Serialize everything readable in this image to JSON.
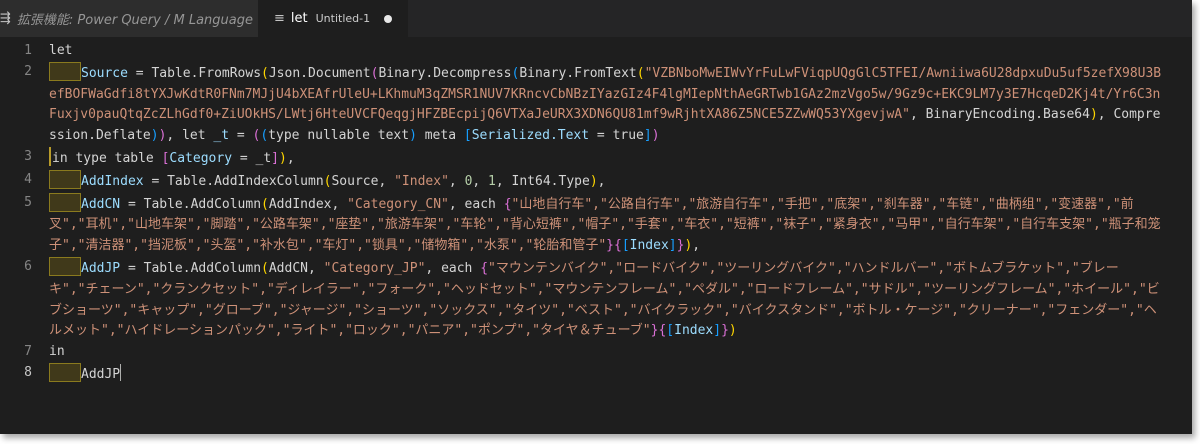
{
  "tabs": [
    {
      "label": "拡張機能: Power Query / M Language",
      "icon": "preview-icon",
      "icon_glyph": "⇶"
    },
    {
      "name": "let",
      "desc": "Untitled-1",
      "icon": "text-lines-icon",
      "icon_glyph": "≡",
      "dirty": true
    }
  ],
  "gutter": {
    "l1": "1",
    "l2": "2",
    "l3": "3",
    "l4": "4",
    "l5": "5",
    "l6": "6",
    "l7": "7",
    "l8": "8"
  },
  "code": {
    "let": "let",
    "in": "in",
    "source_var": "Source",
    "table_fromrows": "Table.FromRows",
    "json_document": "Json.Document",
    "binary_decompress": "Binary.Decompress",
    "binary_fromtext": "Binary.FromText",
    "b64_string": "\"VZBNboMwEIWvYrFuLwFViqpUQgGlC5TFEI/Awniiwa6U28dpxuDu5uf5zefX98U3BefBOFWaGdfi8tYXJwKdtR0FNm7MJjU4bXEAfrUleU+LKhmuM3qZMSR1NUV7KRncvCbNBzIYazGIz4F4lgMIepNthAeGRTwb1GAz2mzVgo5w/9Gz9c+EKC9LM7y3E7HcqeD2Kj4t/Yr6C3nFuxjv0pauQtqZcZLhGdf0+ZiUOkHS/LWtj6HteUVCFQeqgjHFZBEcpijQ6VTXaJeURX3XDN6QU81mf9wRjhtXA86Z5NCE5ZZwWQ53YXgevjwA\"",
    "binaryencoding_base64": "BinaryEncoding.Base64",
    "compression_deflate": "Compression.Deflate",
    "var_t": "_t",
    "type_kw": "type",
    "nullable_text": "nullable text",
    "meta_kw": "meta",
    "serialized_text": "Serialized.Text",
    "true_kw": "true",
    "in_type_table": "in type table",
    "category_field": "Category",
    "addindex_var": "AddIndex",
    "table_addindexcolumn": "Table.AddIndexColumn",
    "index_string": "\"Index\"",
    "num_0": "0",
    "num_1": "1",
    "int64_type": "Int64.Type",
    "addcn_var": "AddCN",
    "table_addcolumn": "Table.AddColumn",
    "category_cn_string": "\"Category_CN\"",
    "each_kw": "each",
    "cn_list": "\"山地自行车\",\"公路自行车\",\"旅游自行车\",\"手把\",\"底架\",\"刹车器\",\"车链\",\"曲柄组\",\"变速器\",\"前叉\",\"耳机\",\"山地车架\",\"脚踏\",\"公路车架\",\"座垫\",\"旅游车架\",\"车轮\",\"背心短裤\",\"帽子\",\"手套\",\"车衣\",\"短裤\",\"袜子\",\"紧身衣\",\"马甲\",\"自行车架\",\"自行车支架\",\"瓶子和笼子\",\"清洁器\",\"挡泥板\",\"头盔\",\"补水包\",\"车灯\",\"锁具\",\"储物箱\",\"水泵\",\"轮胎和管子\"",
    "index_field": "Index",
    "addjp_var": "AddJP",
    "category_jp_string": "\"Category_JP\"",
    "jp_list": "\"マウンテンバイク\",\"ロードバイク\",\"ツーリングバイク\",\"ハンドルバー\",\"ボトムブラケット\",\"ブレーキ\",\"チェーン\",\"クランクセット\",\"ディレイラー\",\"フォーク\",\"ヘッドセット\",\"マウンテンフレーム\",\"ペダル\",\"ロードフレーム\",\"サドル\",\"ツーリングフレーム\",\"ホイール\",\"ビブショーツ\",\"キャップ\",\"グローブ\",\"ジャージ\",\"ショーツ\",\"ソックス\",\"タイツ\",\"ベスト\",\"バイクラック\",\"バイクスタンド\",\"ボトル・ケージ\",\"クリーナー\",\"フェンダー\",\"ヘルメット\",\"ハイドレーションパック\",\"ライト\",\"ロック\",\"パニア\",\"ポンプ\",\"タイヤ＆チューブ\"",
    "final_var": "AddJP"
  }
}
